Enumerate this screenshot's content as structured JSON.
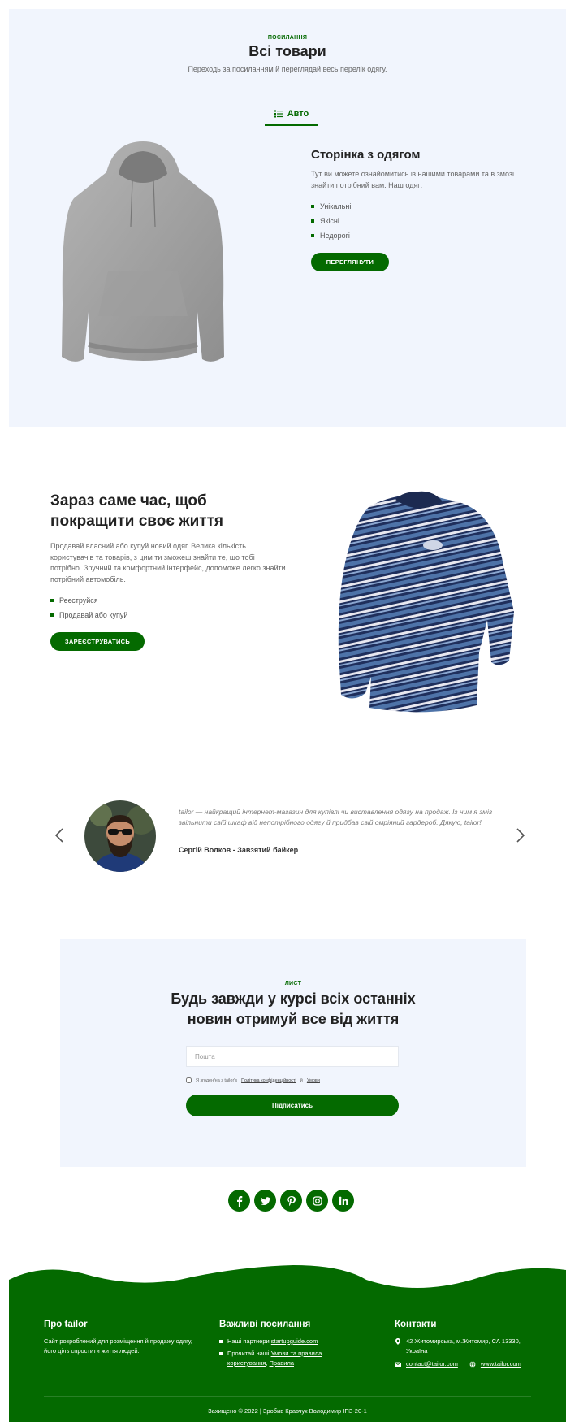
{
  "products": {
    "overline": "ПОСИЛАННЯ",
    "title": "Всі товари",
    "lead": "Переходь за посиланням й переглядай весь перелік одягу.",
    "tab_label": "Авто",
    "card_title": "Сторінка з одягом",
    "card_text": "Тут ви можете ознайомитись із нашими товарами та в змозі знайти потрібний вам. Наш одяг:",
    "features": [
      "Унікальні",
      "Якісні",
      "Недорогі"
    ],
    "button": "ПЕРЕГЛЯНУТИ"
  },
  "promo": {
    "title": "Зараз саме час, щоб покращити своє життя",
    "text": "Продавай власний або купуй новий одяг. Велика кількість користувачів та товарів, з цим ти зможеш знайти те, що тобі потрібно. Зручний та комфортний інтерфейс, допоможе легко знайти потрібний автомобіль.",
    "features": [
      "Реєструйся",
      "Продавай або купуй"
    ],
    "button": "ЗАРЕЄСТРУВАТИСЬ"
  },
  "testimonial": {
    "quote": "tailor — найкращий інтернет-магазин для купівлі чи виставлення одягу на продаж. Із ним я зміг звільнити свій шкаф від непотрібного одягу й придбав свій омріяний гардероб. Дякую, tailor!",
    "author": "Сергій Волков - Завзятий байкер"
  },
  "newsletter": {
    "overline": "ЛИСТ",
    "title_line1": "Будь завжди у курсі всіх останніх",
    "title_line2": "новин отримуй все від життя",
    "email_placeholder": "Пошта",
    "consent_prefix": "Я згоден/на з tailor's",
    "consent_privacy": "Політика конфіденційності",
    "consent_and": "й",
    "consent_terms": "Умови",
    "subscribe": "Підписатись"
  },
  "socials": [
    {
      "icon": "facebook-icon",
      "letter": "f"
    },
    {
      "icon": "twitter-icon",
      "letter": ""
    },
    {
      "icon": "pinterest-icon",
      "letter": "p"
    },
    {
      "icon": "instagram-icon",
      "letter": ""
    },
    {
      "icon": "linkedin-icon",
      "letter": "in"
    }
  ],
  "footer": {
    "about_title": "Про tailor",
    "about_text": "Сайт розроблений для розміщення й продажу одягу, його ціль спростити життя людей.",
    "links_title": "Важливі посилання",
    "link1_prefix": "Наші партнери",
    "link1": "startupguide.com",
    "link2_prefix": "Прочитай наші",
    "link2": "Умови та правила користування",
    "link2_sep": ",",
    "link3": "Правила",
    "contacts_title": "Контакти",
    "address": "42 Житомирська, м.Житомир, СА 13330, Україна",
    "email": "contact@tailor.com",
    "website": "www.tailor.com",
    "copyright": "Захищено © 2022 | Зробив Кравчук Володимир ІПЗ-20-1"
  },
  "colors": {
    "accent": "#046a00",
    "section_bg": "#f1f5fd"
  }
}
